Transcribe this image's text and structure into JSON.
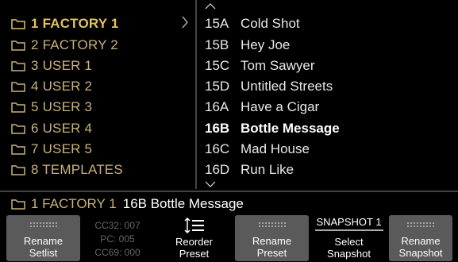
{
  "setlists": [
    {
      "label": "1 FACTORY 1",
      "active": true
    },
    {
      "label": "2 FACTORY 2"
    },
    {
      "label": "3 USER 1"
    },
    {
      "label": "4 USER 2"
    },
    {
      "label": "5 USER 3"
    },
    {
      "label": "6 USER 4"
    },
    {
      "label": "7 USER 5"
    },
    {
      "label": "8 TEMPLATES"
    }
  ],
  "presets": [
    {
      "id": "15A",
      "name": "Cold Shot"
    },
    {
      "id": "15B",
      "name": "Hey Joe"
    },
    {
      "id": "15C",
      "name": "Tom Sawyer"
    },
    {
      "id": "15D",
      "name": "Untitled Streets"
    },
    {
      "id": "16A",
      "name": "Have a Cigar"
    },
    {
      "id": "16B",
      "name": "Bottle Message",
      "active": true
    },
    {
      "id": "16C",
      "name": "Mad House"
    },
    {
      "id": "16D",
      "name": "Run Like"
    }
  ],
  "status": {
    "setlist": "1 FACTORY 1",
    "preset": "16B Bottle Message"
  },
  "buttons": {
    "rename_setlist": [
      "Rename",
      "Setlist"
    ],
    "cc": [
      "CC32: 007",
      "PC: 005",
      "CC69: 000"
    ],
    "reorder_preset": [
      "Reorder",
      "Preset"
    ],
    "rename_preset": [
      "Rename",
      "Preset"
    ],
    "snapshot_name": "SNAPSHOT 1",
    "select_snapshot": [
      "Select",
      "Snapshot"
    ],
    "rename_snapshot": [
      "Rename",
      "Snapshot"
    ]
  },
  "colors": {
    "setlist_text": "#c9b27a",
    "setlist_active": "#e2c160",
    "button_bg": "#5a5a5a"
  },
  "icons": [
    "folder-icon",
    "chevron-right-icon",
    "chevron-up-icon",
    "chevron-down-icon",
    "reorder-icon"
  ]
}
